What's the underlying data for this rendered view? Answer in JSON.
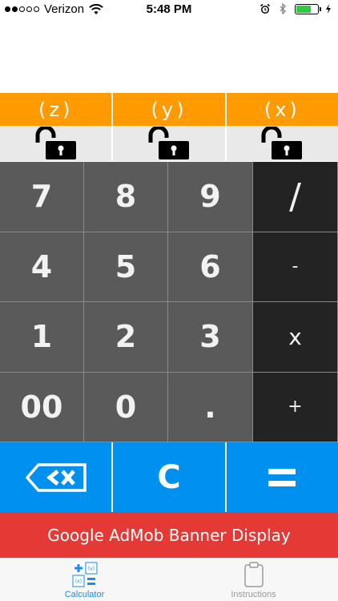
{
  "status_bar": {
    "carrier": "Verizon",
    "time": "5:48 PM",
    "signal_bars_filled": 2,
    "signal_bars_total": 5,
    "battery_level_percent": 70,
    "icons": [
      "wifi-icon",
      "alarm-icon",
      "bluetooth-icon",
      "battery-icon",
      "charging-bolt-icon"
    ]
  },
  "variables": {
    "z_label": "(z)",
    "y_label": "(y)",
    "x_label": "(x)"
  },
  "locks": [
    "unlocked-padlock-icon",
    "unlocked-padlock-icon",
    "unlocked-padlock-icon"
  ],
  "keypad": {
    "k7": "7",
    "k8": "8",
    "k9": "9",
    "divide": "/",
    "k4": "4",
    "k5": "5",
    "k6": "6",
    "minus": "-",
    "k1": "1",
    "k2": "2",
    "k3": "3",
    "multiply": "x",
    "k00": "00",
    "k0": "0",
    "dot": ".",
    "plus": "+"
  },
  "actions": {
    "backspace_icon": "backspace-x-icon",
    "clear_label": "C",
    "equals_icon": "equals-icon"
  },
  "ad_banner": {
    "text": "Google AdMob Banner Display"
  },
  "tab_bar": {
    "tabs": [
      {
        "label": "Calculator",
        "icon": "calculator-icon",
        "active": true
      },
      {
        "label": "Instructions",
        "icon": "clipboard-icon",
        "active": false
      }
    ]
  },
  "colors": {
    "variable_header": "#ff9a00",
    "digit_key": "#5a5a5a",
    "operator_key": "#232323",
    "action_key": "#0090f0",
    "ad_banner": "#e53935",
    "active_tab": "#1a8ef0"
  }
}
